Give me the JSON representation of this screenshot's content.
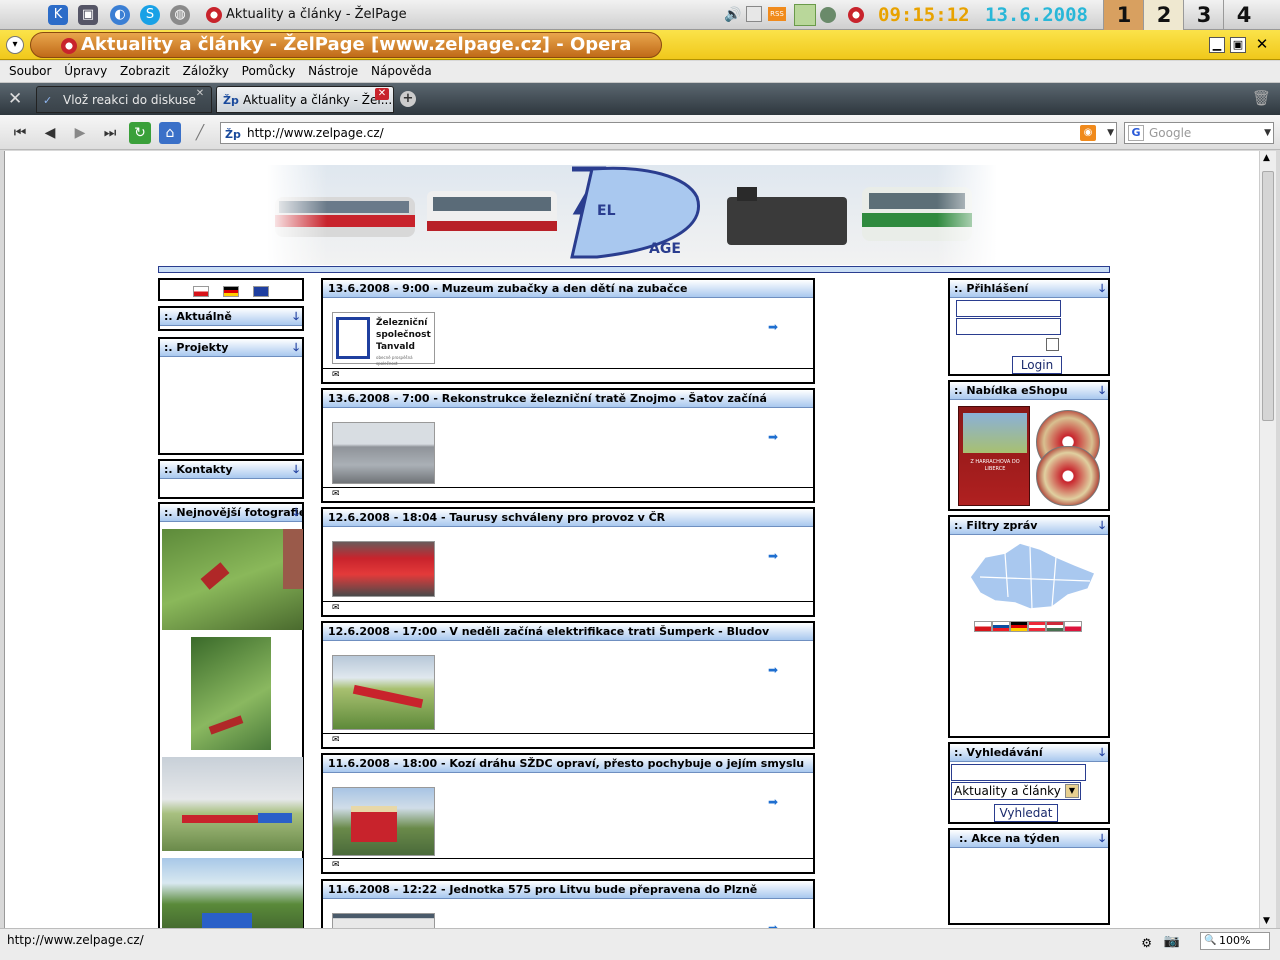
{
  "taskbar": {
    "task_title": "Aktuality a články - ŽelPage",
    "clock": "09:15:12",
    "date": "13.6.2008",
    "desktops": [
      "1",
      "2",
      "3",
      "4"
    ]
  },
  "window": {
    "title": "Aktuality a články - ŽelPage [www.zelpage.cz] - Opera"
  },
  "menu": [
    "Soubor",
    "Úpravy",
    "Zobrazit",
    "Záložky",
    "Pomůcky",
    "Nástroje",
    "Nápověda"
  ],
  "tabs": [
    {
      "label": "Vlož reakci do diskuse"
    },
    {
      "label": "Aktuality a články - Žel..."
    }
  ],
  "address": {
    "url": "http://www.zelpage.cz/",
    "search_placeholder": "Google"
  },
  "status": {
    "text": "http://www.zelpage.cz/",
    "zoom": "100%"
  },
  "site": {
    "logo_text": "ŽELPAGE",
    "left": {
      "aktualne": ":. Aktuálně",
      "projekty": ":. Projekty",
      "kontakty": ":. Kontakty",
      "fotografie": ":. Nejnovější fotografie"
    },
    "news": [
      {
        "title": "13.6.2008 - 9:00 - Muzeum zubačky a den dětí na zubačce",
        "logo_lines": [
          "Železniční",
          "společnost",
          "Tanvald"
        ],
        "logo_sub": "obecně prospěšná společnost"
      },
      {
        "title": "13.6.2008 - 7:00 - Rekonstrukce železniční tratě Znojmo - Šatov začíná"
      },
      {
        "title": "12.6.2008 - 18:04 - Taurusy schváleny pro provoz v ČR"
      },
      {
        "title": "12.6.2008 - 17:00 - V neděli začíná elektrifikace trati Šumperk - Bludov"
      },
      {
        "title": "11.6.2008 - 18:00 - Kozí dráhu SŽDC opraví, přesto pochybuje o jejím smyslu"
      },
      {
        "title": "11.6.2008 - 12:22 - Jednotka 575 pro Litvu bude přepravena do Plzně"
      }
    ],
    "right": {
      "login_title": ":. Přihlášení",
      "login_button": "Login",
      "eshop_title": ":. Nabídka eShopu",
      "eshop_cover": "Z HARRACHOVA DO LIBERCE",
      "filters_title": ":. Filtry zpráv",
      "search_title": ":. Vyhledávání",
      "search_select": "Aktuality a články",
      "search_button": "Vyhledat",
      "akce_title": ":. Akce na týden"
    }
  },
  "colors": {
    "accent": "#a9c8ef",
    "border": "#000000",
    "titlebar": "#f0c81b",
    "link_arrow": "#1f6fd0"
  }
}
